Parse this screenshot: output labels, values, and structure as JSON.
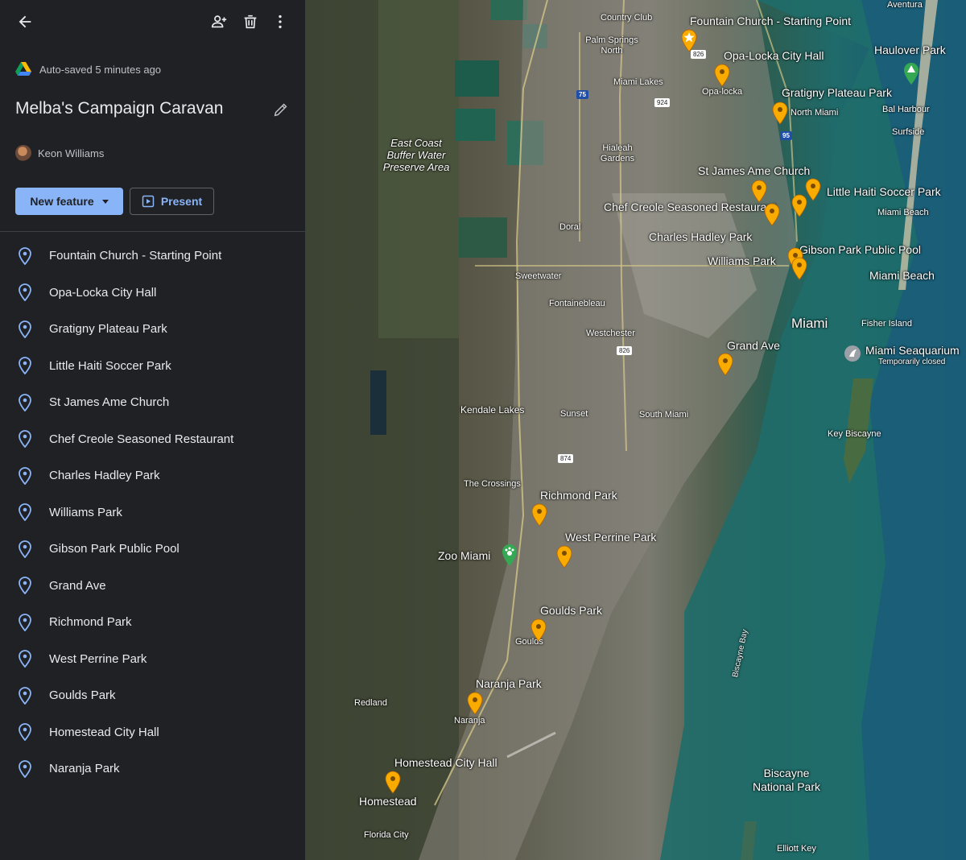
{
  "header": {
    "autosave_text": "Auto-saved 5 minutes ago",
    "map_title": "Melba's Campaign Caravan",
    "owner_name": "Keon Williams"
  },
  "toolbar": {
    "new_feature_label": "New feature",
    "present_label": "Present"
  },
  "features": [
    "Fountain Church - Starting Point",
    "Opa-Locka City Hall",
    "Gratigny Plateau Park",
    "Little Haiti Soccer Park",
    "St James Ame Church",
    "Chef Creole Seasoned Restaurant",
    "Charles Hadley Park",
    "Williams Park",
    "Gibson Park Public Pool",
    "Grand Ave",
    "Richmond Park",
    "West Perrine Park",
    "Goulds Park",
    "Homestead City Hall",
    "Naranja Park"
  ],
  "map": {
    "feature_labels": {
      "fountain": "Fountain Church - Starting Point",
      "opalocka": "Opa-Locka City Hall",
      "gratigny": "Gratigny Plateau Park",
      "stjames": "St James Ame Church",
      "littlehaiti": "Little Haiti Soccer Park",
      "chefcreole": "Chef Creole Seasoned Restaurant",
      "charleshadley": "Charles Hadley Park",
      "gibson": "Gibson Park Public Pool",
      "williams": "Williams Park",
      "grandave": "Grand Ave",
      "richmond": "Richmond Park",
      "westperrine": "West Perrine Park",
      "goulds": "Goulds Park",
      "naranja": "Naranja Park",
      "homestead": "Homestead City Hall"
    },
    "place_labels": {
      "aventura": "Aventura",
      "countryclub": "Country Club",
      "palmsprings": "Palm Springs North",
      "haulover": "Haulover Park",
      "miamilakes": "Miami Lakes",
      "opalocka_town": "Opa-locka",
      "northmiami": "North Miami",
      "balharbour": "Bal Harbour",
      "surfside": "Surfside",
      "hialeah": "Hialeah Gardens",
      "eastcoast": "East Coast Buffer Water Preserve Area",
      "miamibeach1": "Miami Beach",
      "doral": "Doral",
      "miamibeach2": "Miami Beach",
      "sweetwater": "Sweetwater",
      "fontainebleau": "Fontainebleau",
      "miami": "Miami",
      "fisherisland": "Fisher Island",
      "westchester": "Westchester",
      "seaquarium": "Miami Seaquarium",
      "seaquarium_status": "Temporarily closed",
      "kendale": "Kendale Lakes",
      "sunset": "Sunset",
      "southmiami": "South Miami",
      "keybiscayne": "Key Biscayne",
      "crossings": "The Crossings",
      "zoomiami": "Zoo Miami",
      "goulds_town": "Goulds",
      "biscaynebay": "Biscayne Bay",
      "redland": "Redland",
      "naranja_town": "Naranja",
      "homestead_town": "Homestead",
      "biscaynepark": "Biscayne National Park",
      "floridacity": "Florida City",
      "elliottkey": "Elliott Key"
    },
    "shields": {
      "r826a": "826",
      "i75": "75",
      "r924": "924",
      "i95": "95",
      "r826b": "826",
      "r874": "874"
    }
  },
  "colors": {
    "sidebar_bg": "#202124",
    "accent": "#8ab4f8",
    "marker": "#f9ab00"
  },
  "icons": [
    "back-arrow-icon",
    "add-person-icon",
    "trash-icon",
    "more-vert-icon",
    "drive-icon",
    "pencil-icon",
    "present-icon",
    "place-pin-icon",
    "map-marker-icon",
    "star-marker-icon",
    "paw-icon",
    "seaquarium-icon"
  ]
}
